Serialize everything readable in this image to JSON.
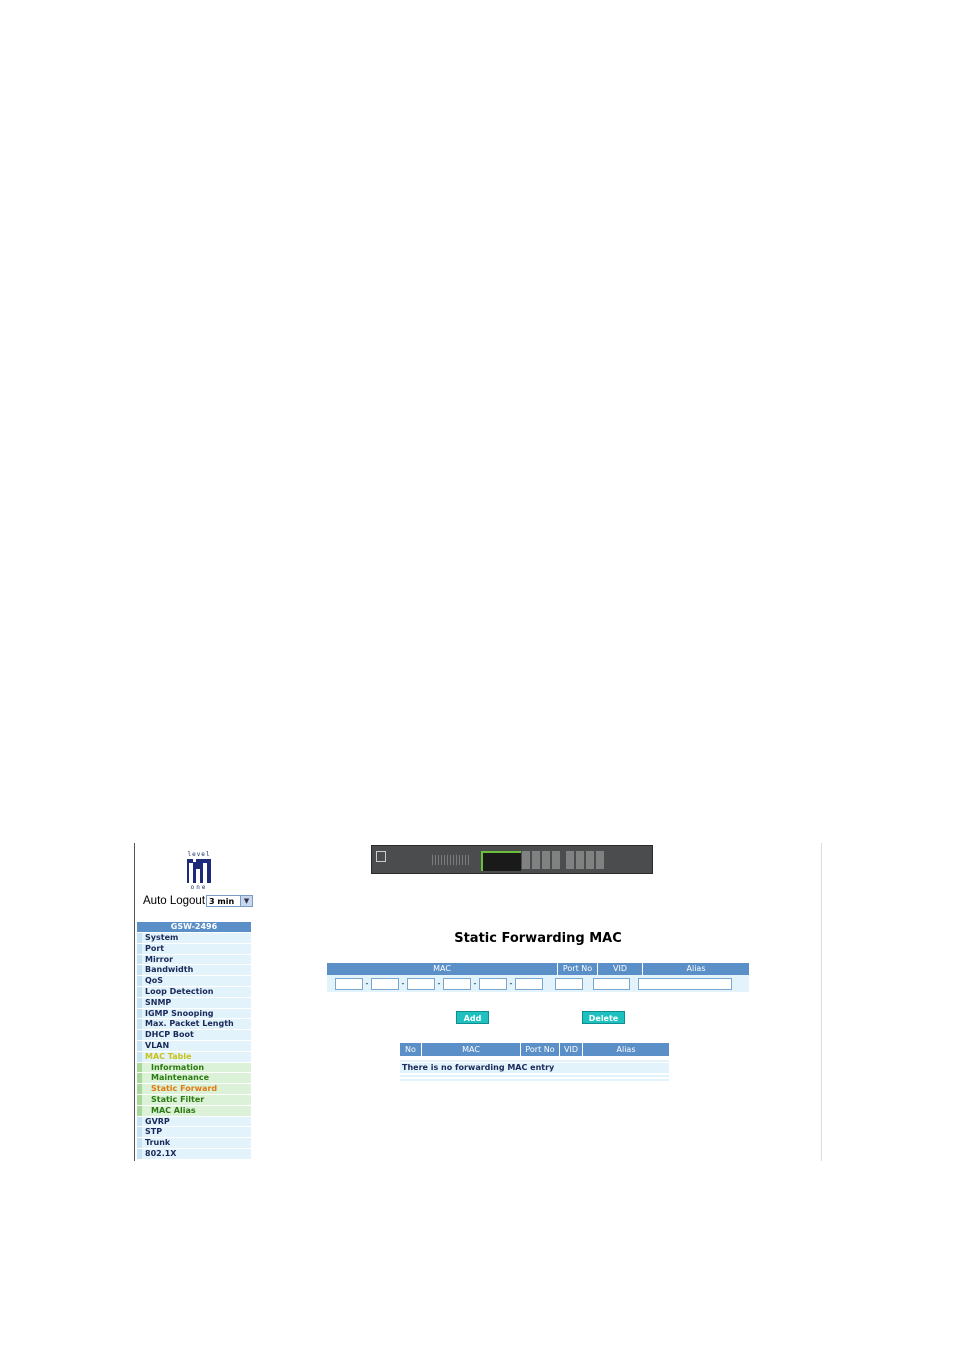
{
  "brand": {
    "logo_top": "level",
    "logo_bottom": "one"
  },
  "auto_logout": {
    "label": "Auto Logout",
    "value": "3 min"
  },
  "sidebar": {
    "header": "GSW-2496",
    "items": [
      {
        "label": "System"
      },
      {
        "label": "Port"
      },
      {
        "label": "Mirror"
      },
      {
        "label": "Bandwidth"
      },
      {
        "label": "QoS"
      },
      {
        "label": "Loop Detection"
      },
      {
        "label": "SNMP"
      },
      {
        "label": "IGMP Snooping"
      },
      {
        "label": "Max. Packet Length"
      },
      {
        "label": "DHCP Boot"
      },
      {
        "label": "VLAN"
      },
      {
        "label": "MAC Table"
      },
      {
        "label": "Information"
      },
      {
        "label": "Maintenance"
      },
      {
        "label": "Static Forward"
      },
      {
        "label": "Static Filter"
      },
      {
        "label": "MAC Alias"
      },
      {
        "label": "GVRP"
      },
      {
        "label": "STP"
      },
      {
        "label": "Trunk"
      },
      {
        "label": "802.1X"
      }
    ]
  },
  "main": {
    "title": "Static Forwarding MAC",
    "entry_table": {
      "headers": {
        "mac": "MAC",
        "port": "Port No",
        "vid": "VID",
        "alias": "Alias"
      },
      "separator": "-"
    },
    "buttons": {
      "add": "Add",
      "delete": "Delete"
    },
    "list_table": {
      "headers": {
        "no": "No",
        "mac": "MAC",
        "port": "Port No",
        "vid": "VID",
        "alias": "Alias"
      },
      "empty_message": "There is no forwarding MAC entry"
    }
  },
  "colors": {
    "header_blue": "#5b8fc7",
    "row_light": "#e2f3fb",
    "button_teal": "#1fc0c0",
    "active_menu": "#c8c21a",
    "current_sub": "#e07a10"
  }
}
